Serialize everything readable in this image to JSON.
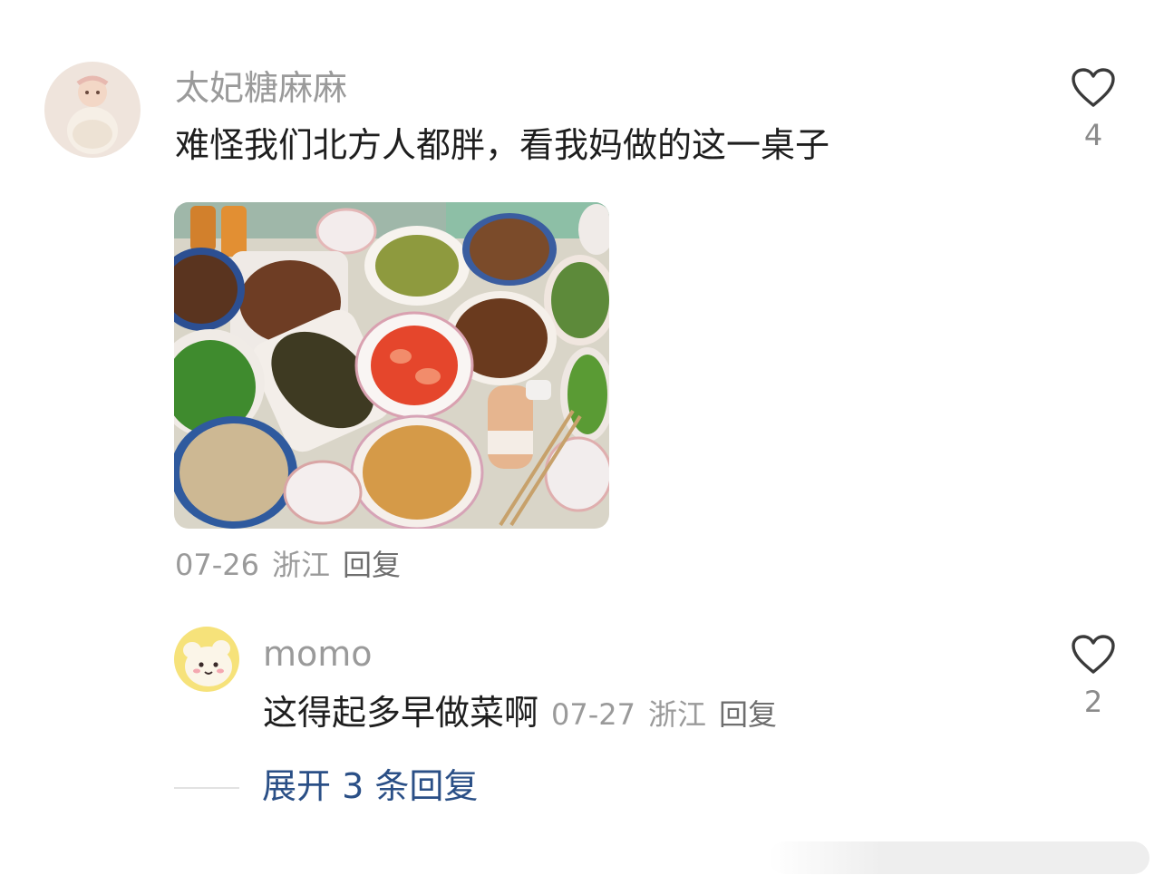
{
  "comments": [
    {
      "username": "太妃糖麻麻",
      "text": "难怪我们北方人都胖，看我妈做的这一桌子",
      "date": "07-26",
      "location": "浙江",
      "reply_label": "回复",
      "like_count": "4",
      "has_image": true
    }
  ],
  "reply": {
    "username": "momo",
    "text": "这得起多早做菜啊",
    "date": "07-27",
    "location": "浙江",
    "reply_label": "回复",
    "like_count": "2"
  },
  "expand_replies_label": "展开 3 条回复",
  "colors": {
    "username": "#9a9a9a",
    "text": "#1e1e1e",
    "link": "#2a4f86"
  },
  "icons": {
    "like": "heart-outline-icon"
  }
}
